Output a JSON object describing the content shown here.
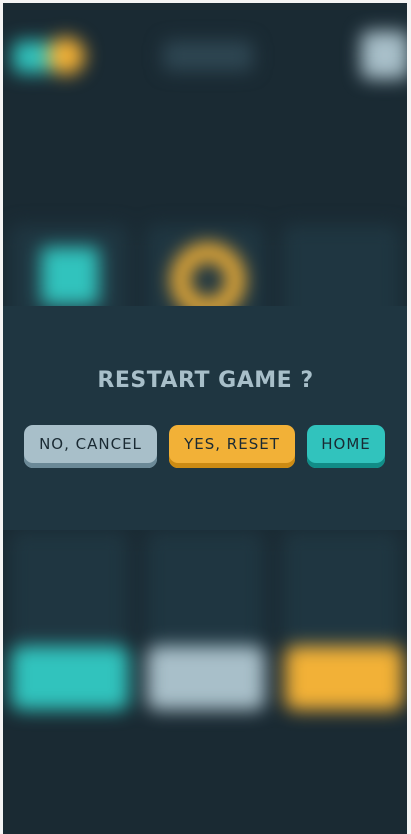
{
  "dialog": {
    "title": "RESTART GAME ?",
    "cancel_label": "NO, CANCEL",
    "reset_label": "YES, RESET",
    "home_label": "HOME"
  },
  "colors": {
    "background": "#1a2a33",
    "panel": "#1f3641",
    "silver": "#a8bfc9",
    "yellow": "#f2b137",
    "teal": "#31c3bd"
  },
  "board": {
    "marks": [
      "x",
      "o",
      "",
      "",
      "",
      "",
      "",
      "",
      ""
    ]
  }
}
